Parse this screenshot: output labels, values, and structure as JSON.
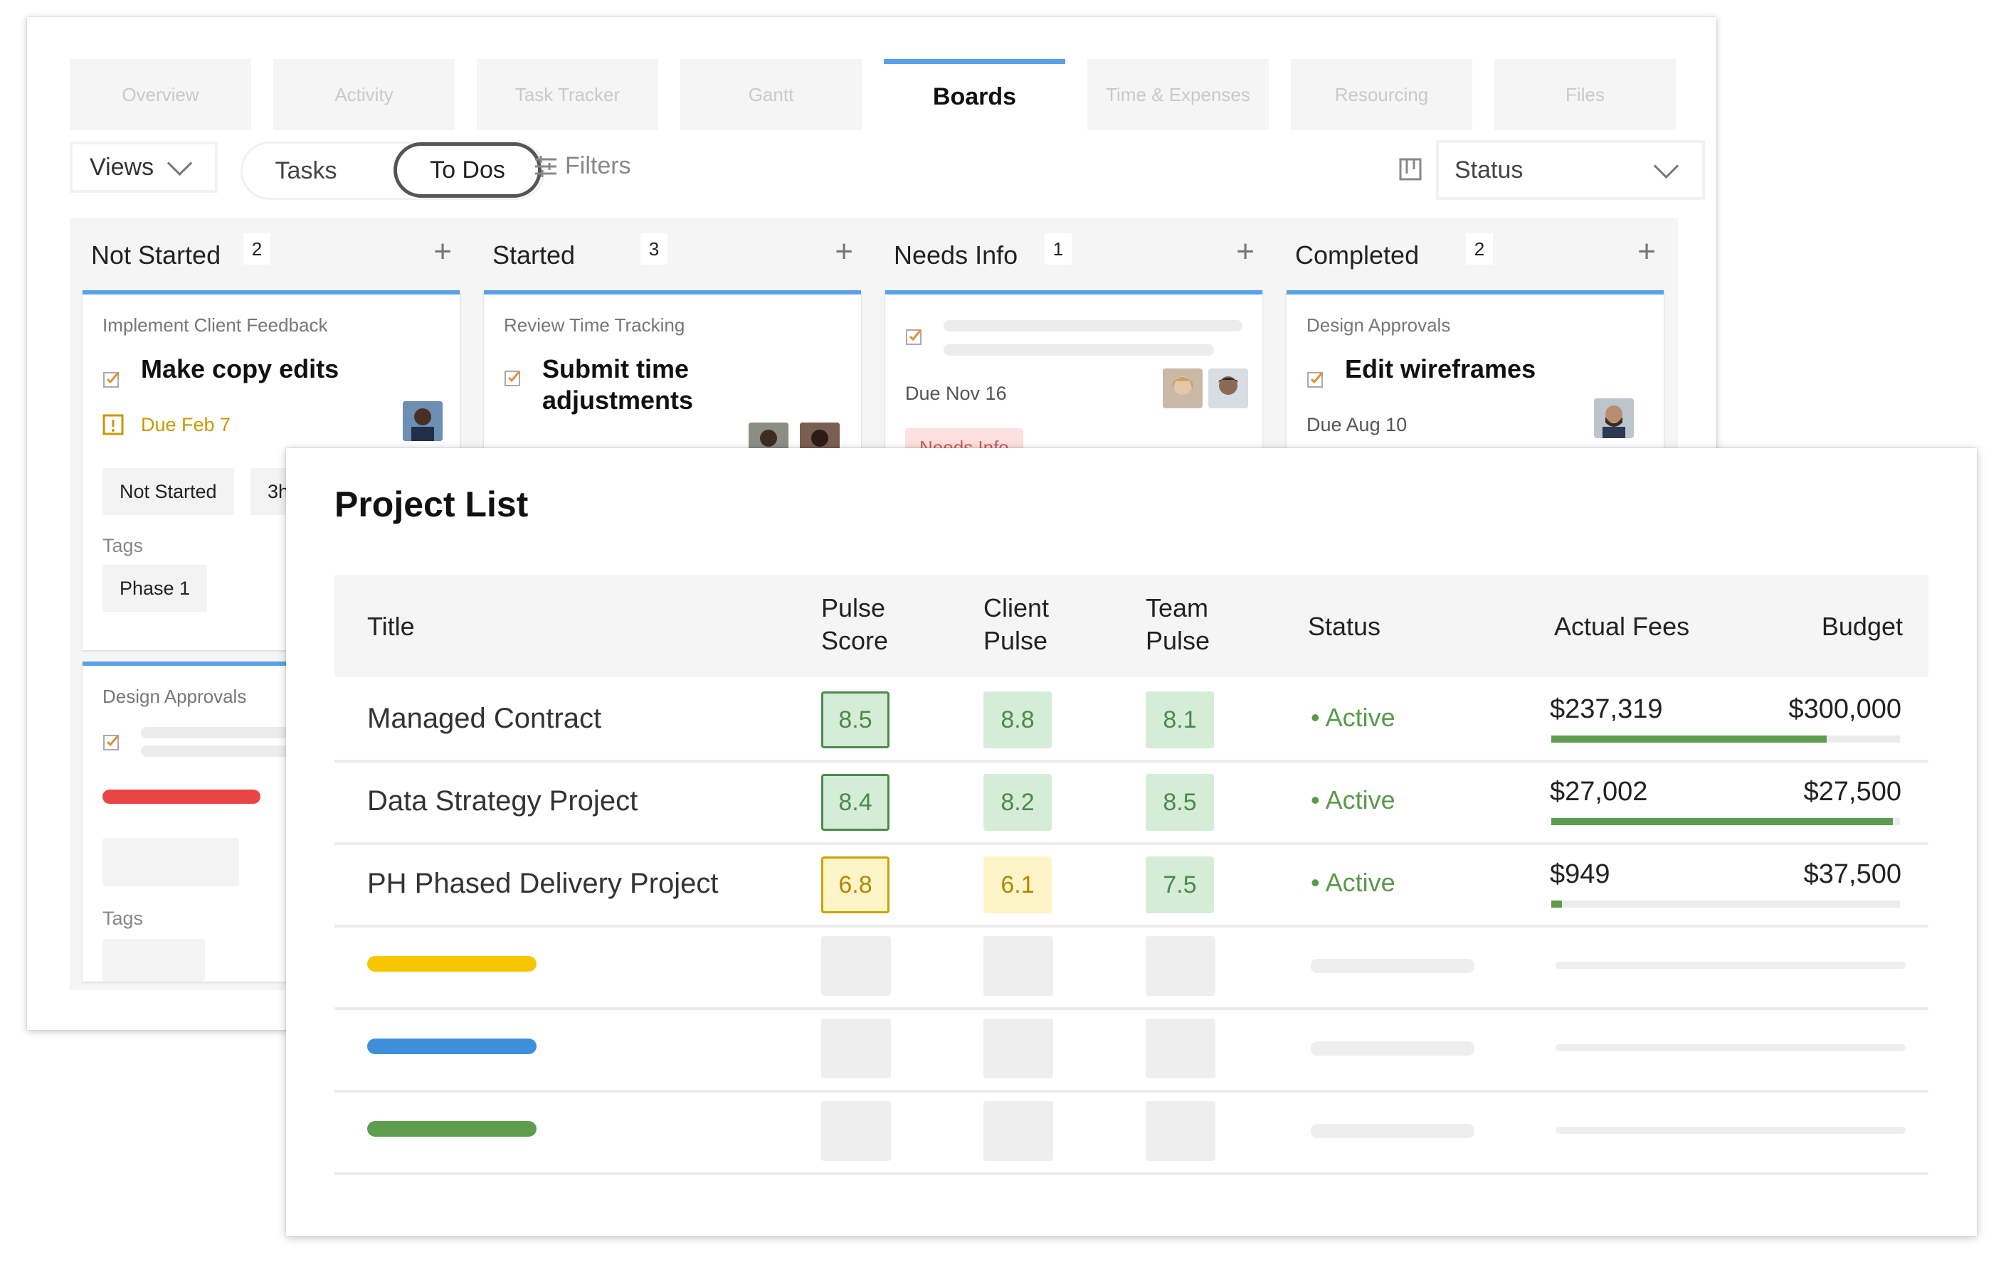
{
  "tabs": [
    "Overview",
    "Activity",
    "Task Tracker",
    "Gantt",
    "Boards",
    "Time & Expenses",
    "Resourcing",
    "Files"
  ],
  "active_tab": "Boards",
  "toolbar": {
    "views": "Views",
    "tasks": "Tasks",
    "todos": "To Dos",
    "filters": "Filters",
    "status": "Status"
  },
  "columns": [
    {
      "title": "Not Started",
      "count": "2"
    },
    {
      "title": "Started",
      "count": "3"
    },
    {
      "title": "Needs Info",
      "count": "1"
    },
    {
      "title": "Completed",
      "count": "2"
    }
  ],
  "cards": {
    "c1": {
      "project": "Implement Client Feedback",
      "title": "Make copy edits",
      "due": "Due Feb 7",
      "status": "Not Started",
      "hours": "3h",
      "tags_label": "Tags",
      "tag": "Phase 1"
    },
    "c2": {
      "project": "Review Time Tracking",
      "title_line1": "Submit time",
      "title_line2": "adjustments"
    },
    "c3": {
      "due": "Due Nov 16",
      "badge": "Needs Info"
    },
    "c4": {
      "project": "Design Approvals",
      "title": "Edit wireframes",
      "due": "Due Aug 10"
    },
    "c5": {
      "project": "Design Approvals",
      "tags_label": "Tags"
    }
  },
  "project_list": {
    "title": "Project List",
    "headers": {
      "title": "Title",
      "pulse_score_1": "Pulse",
      "pulse_score_2": "Score",
      "client_pulse_1": "Client",
      "client_pulse_2": "Pulse",
      "team_pulse_1": "Team",
      "team_pulse_2": "Pulse",
      "status": "Status",
      "actual_fees": "Actual Fees",
      "budget": "Budget"
    },
    "rows": [
      {
        "title": "Managed Contract",
        "pulse_score": "8.5",
        "client_pulse": "8.8",
        "team_pulse": "8.1",
        "status": "• Active",
        "actual_fees": "$237,319",
        "budget": "$300,000",
        "spent_fraction": 0.79
      },
      {
        "title": "Data Strategy Project",
        "pulse_score": "8.4",
        "client_pulse": "8.2",
        "team_pulse": "8.5",
        "status": "• Active",
        "actual_fees": "$27,002",
        "budget": "$27,500",
        "spent_fraction": 0.98
      },
      {
        "title": "PH Phased Delivery Project",
        "pulse_score": "6.8",
        "client_pulse": "6.1",
        "team_pulse": "7.5",
        "status": "• Active",
        "actual_fees": "$949",
        "budget": "$37,500",
        "spent_fraction": 0.03
      }
    ],
    "placeholder_bar_colors": [
      "#f7c600",
      "#3d8fda",
      "#5e9c4e"
    ]
  }
}
